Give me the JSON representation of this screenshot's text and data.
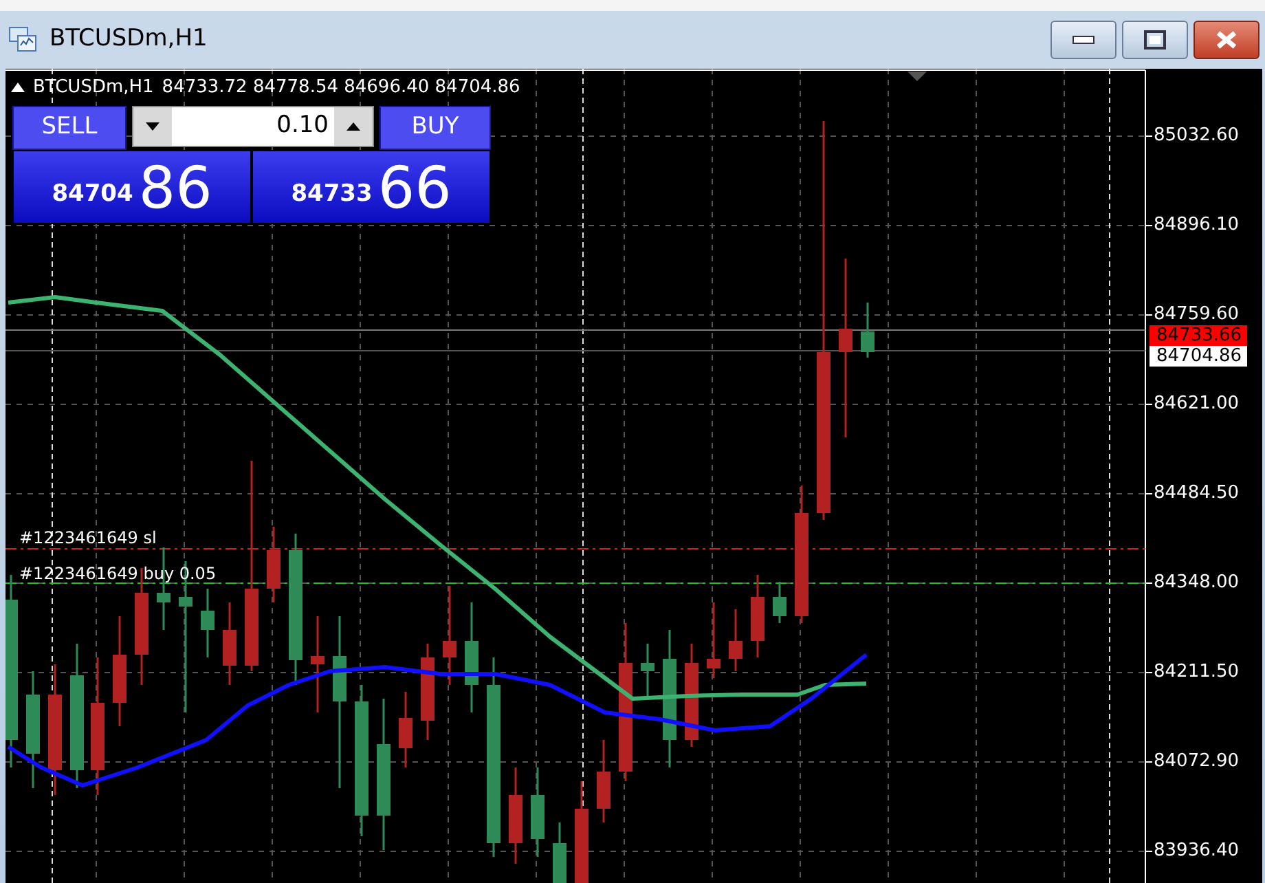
{
  "window": {
    "title": "BTCUSDm,H1"
  },
  "chart": {
    "header": {
      "symbol": "BTCUSDm,H1",
      "ohlc": "84733.72 84778.54 84696.40 84704.86"
    },
    "trade_panel": {
      "sell_label": "SELL",
      "buy_label": "BUY",
      "volume": "0.10",
      "sell_price": {
        "main": "84704",
        "big": "86"
      },
      "buy_price": {
        "main": "84733",
        "big": "66"
      }
    },
    "order_lines": [
      {
        "kind": "sl",
        "text": "#1223461649 sl"
      },
      {
        "kind": "entry",
        "text": "#1223461649 buy 0.05"
      }
    ],
    "price_axis": [
      "85032.60",
      "84896.10",
      "84759.60",
      "84621.00",
      "84484.50",
      "84348.00",
      "84211.50",
      "84072.90",
      "83936.40"
    ],
    "price_tags": [
      {
        "kind": "ask",
        "text": "84733.66"
      },
      {
        "kind": "bid",
        "text": "84704.86"
      }
    ]
  }
}
